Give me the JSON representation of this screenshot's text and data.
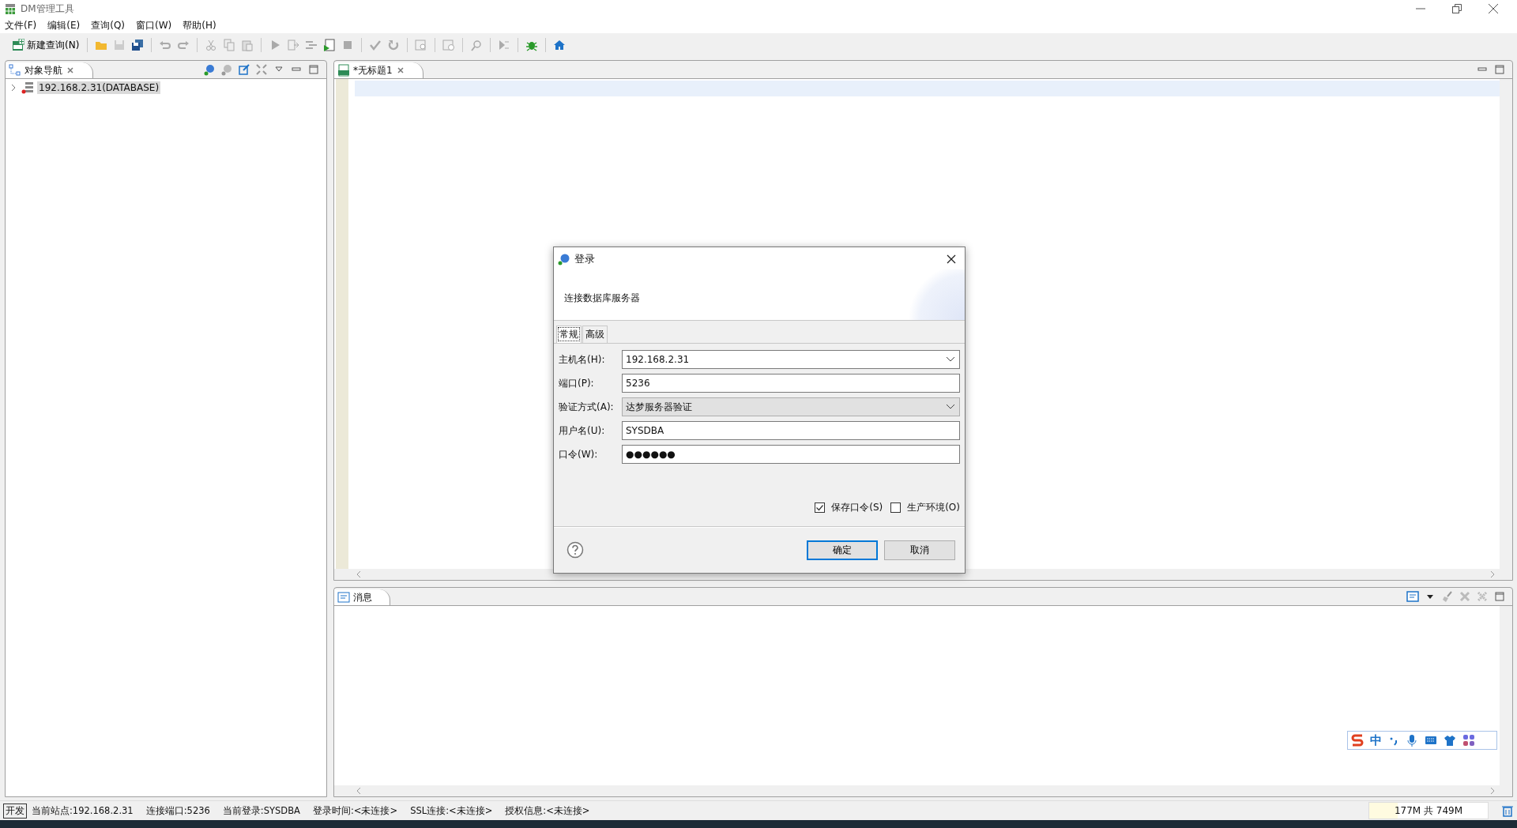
{
  "window": {
    "title": "DM管理工具"
  },
  "menu": [
    "文件(F)",
    "编辑(E)",
    "查询(Q)",
    "窗口(W)",
    "帮助(H)"
  ],
  "toolbar": {
    "new_query": "新建查询(N)"
  },
  "navigator": {
    "tab": "对象导航",
    "tree": [
      {
        "label": "192.168.2.31(DATABASE)",
        "expanded": false,
        "selected": true
      }
    ]
  },
  "editor": {
    "tab": "*无标题1"
  },
  "messages": {
    "tab": "消息"
  },
  "dialog": {
    "title": "登录",
    "subtitle": "连接数据库服务器",
    "tabs": [
      {
        "label": "常规",
        "selected": true
      },
      {
        "label": "高级",
        "selected": false
      }
    ],
    "fields": [
      {
        "kind": "combo",
        "label": "主机名(H):",
        "value": "192.168.2.31"
      },
      {
        "kind": "text",
        "label": "端口(P):",
        "value": "5236"
      },
      {
        "kind": "select",
        "label": "验证方式(A):",
        "value": "达梦服务器验证"
      },
      {
        "kind": "text",
        "label": "用户名(U):",
        "value": "SYSDBA"
      },
      {
        "kind": "text",
        "label": "口令(W):",
        "value": "●●●●●●"
      }
    ],
    "checkboxes": [
      {
        "label": "保存口令(S)",
        "checked": true
      },
      {
        "label": "生产环境(O)",
        "checked": false
      }
    ],
    "buttons": [
      {
        "label": "确定",
        "default": true
      },
      {
        "label": "取消",
        "default": false
      }
    ]
  },
  "status_bar": {
    "badge": "开发",
    "items": [
      "当前站点:192.168.2.31",
      "连接端口:5236",
      "当前登录:SYSDBA",
      "登录时间:<未连接>",
      "SSL连接:<未连接>",
      "授权信息:<未连接>"
    ],
    "memory": "177M 共 749M",
    "level": 0.24
  },
  "ime": {
    "label": "中"
  }
}
